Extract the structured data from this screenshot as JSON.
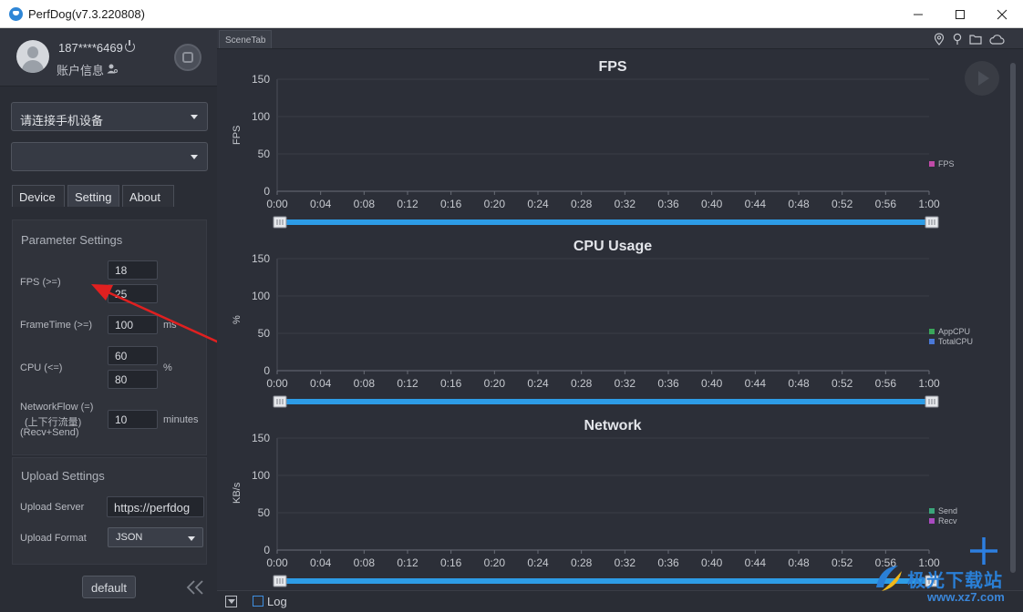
{
  "window": {
    "title": "PerfDog(v7.3.220808)"
  },
  "account": {
    "phone": "187****6469",
    "info_label": "账户信息"
  },
  "device_select": {
    "value": "请连接手机设备"
  },
  "app_select": {
    "value": ""
  },
  "tabs": [
    {
      "label": "Device"
    },
    {
      "label": "Setting",
      "active": true
    },
    {
      "label": "About"
    }
  ],
  "params": {
    "title": "Parameter Settings",
    "fps_label": "FPS (>=)",
    "fps_values": [
      "18",
      "25"
    ],
    "frametime_label": "FrameTime (>=)",
    "frametime_value": "100",
    "frametime_unit": "ms",
    "cpu_label": "CPU (<=)",
    "cpu_values": [
      "60",
      "80"
    ],
    "cpu_unit": "%",
    "network_label": "NetworkFlow (=)",
    "network_sub1": "(上下行流量)",
    "network_sub2": "(Recv+Send)",
    "network_value": "10",
    "network_unit": "minutes"
  },
  "upload": {
    "title": "Upload Settings",
    "server_label": "Upload Server",
    "server_value": "https://perfdog",
    "format_label": "Upload Format",
    "format_value": "JSON"
  },
  "default_button": "default",
  "scene_tab": "SceneTab",
  "log_label": "Log",
  "watermark": {
    "text1": "极光下载站",
    "text2": "www.xz7.com"
  },
  "colors": {
    "accent": "#2d9ce6",
    "fps": "#c04aa8",
    "appcpu": "#3aa55a",
    "totalcpu": "#4a78d8",
    "send": "#3aa57a",
    "recv": "#a94ac0"
  },
  "chart_data": [
    {
      "type": "line",
      "title": "FPS",
      "ylabel": "FPS",
      "ylim": [
        0,
        150
      ],
      "yticks": [
        "150",
        "100",
        "50",
        "0"
      ],
      "xticks": [
        "0:00",
        "0:04",
        "0:08",
        "0:12",
        "0:16",
        "0:20",
        "0:24",
        "0:28",
        "0:32",
        "0:36",
        "0:40",
        "0:44",
        "0:48",
        "0:52",
        "0:56",
        "1:00"
      ],
      "series": [
        {
          "name": "FPS",
          "values": []
        }
      ]
    },
    {
      "type": "line",
      "title": "CPU Usage",
      "ylabel": "%",
      "ylim": [
        0,
        150
      ],
      "yticks": [
        "150",
        "100",
        "50",
        "0"
      ],
      "xticks": [
        "0:00",
        "0:04",
        "0:08",
        "0:12",
        "0:16",
        "0:20",
        "0:24",
        "0:28",
        "0:32",
        "0:36",
        "0:40",
        "0:44",
        "0:48",
        "0:52",
        "0:56",
        "1:00"
      ],
      "series": [
        {
          "name": "AppCPU",
          "values": []
        },
        {
          "name": "TotalCPU",
          "values": []
        }
      ]
    },
    {
      "type": "line",
      "title": "Network",
      "ylabel": "KB/s",
      "ylim": [
        0,
        150
      ],
      "yticks": [
        "150",
        "100",
        "50",
        "0"
      ],
      "xticks": [
        "0:00",
        "0:04",
        "0:08",
        "0:12",
        "0:16",
        "0:20",
        "0:24",
        "0:28",
        "0:32",
        "0:36",
        "0:40",
        "0:44",
        "0:48",
        "0:52",
        "0:56",
        "1:00"
      ],
      "series": [
        {
          "name": "Send",
          "values": []
        },
        {
          "name": "Recv",
          "values": []
        }
      ]
    }
  ]
}
